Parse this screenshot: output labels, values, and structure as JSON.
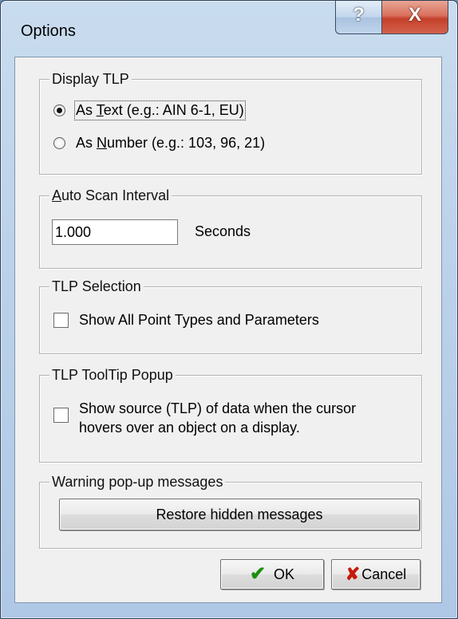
{
  "window": {
    "title": "Options",
    "help_glyph": "?",
    "close_glyph": "X"
  },
  "display_tlp": {
    "legend": "Display TLP",
    "options": [
      {
        "pre": "As ",
        "underline": "T",
        "post": "ext (e.g.: AIN 6-1, EU)",
        "checked": true
      },
      {
        "pre": "As ",
        "underline": "N",
        "post": "umber (e.g.: 103, 96, 21)",
        "checked": false
      }
    ]
  },
  "auto_scan": {
    "legend_underline": "A",
    "legend_rest": "uto Scan Interval",
    "value": "1.000",
    "unit": "Seconds"
  },
  "tlp_selection": {
    "legend": "TLP Selection",
    "checkbox_label": "Show All Point Types and Parameters",
    "checked": false
  },
  "tooltip_popup": {
    "legend": "TLP ToolTip Popup",
    "checkbox_line1": "Show source (TLP) of data when the cursor",
    "checkbox_line2": "hovers over an object on a display.",
    "checked": false
  },
  "warnings": {
    "legend": "Warning pop-up messages",
    "restore_label": "Restore hidden messages"
  },
  "footer": {
    "ok_label": "OK",
    "cancel_label": "Cancel",
    "ok_icon": "✔",
    "cancel_icon": "✘"
  }
}
